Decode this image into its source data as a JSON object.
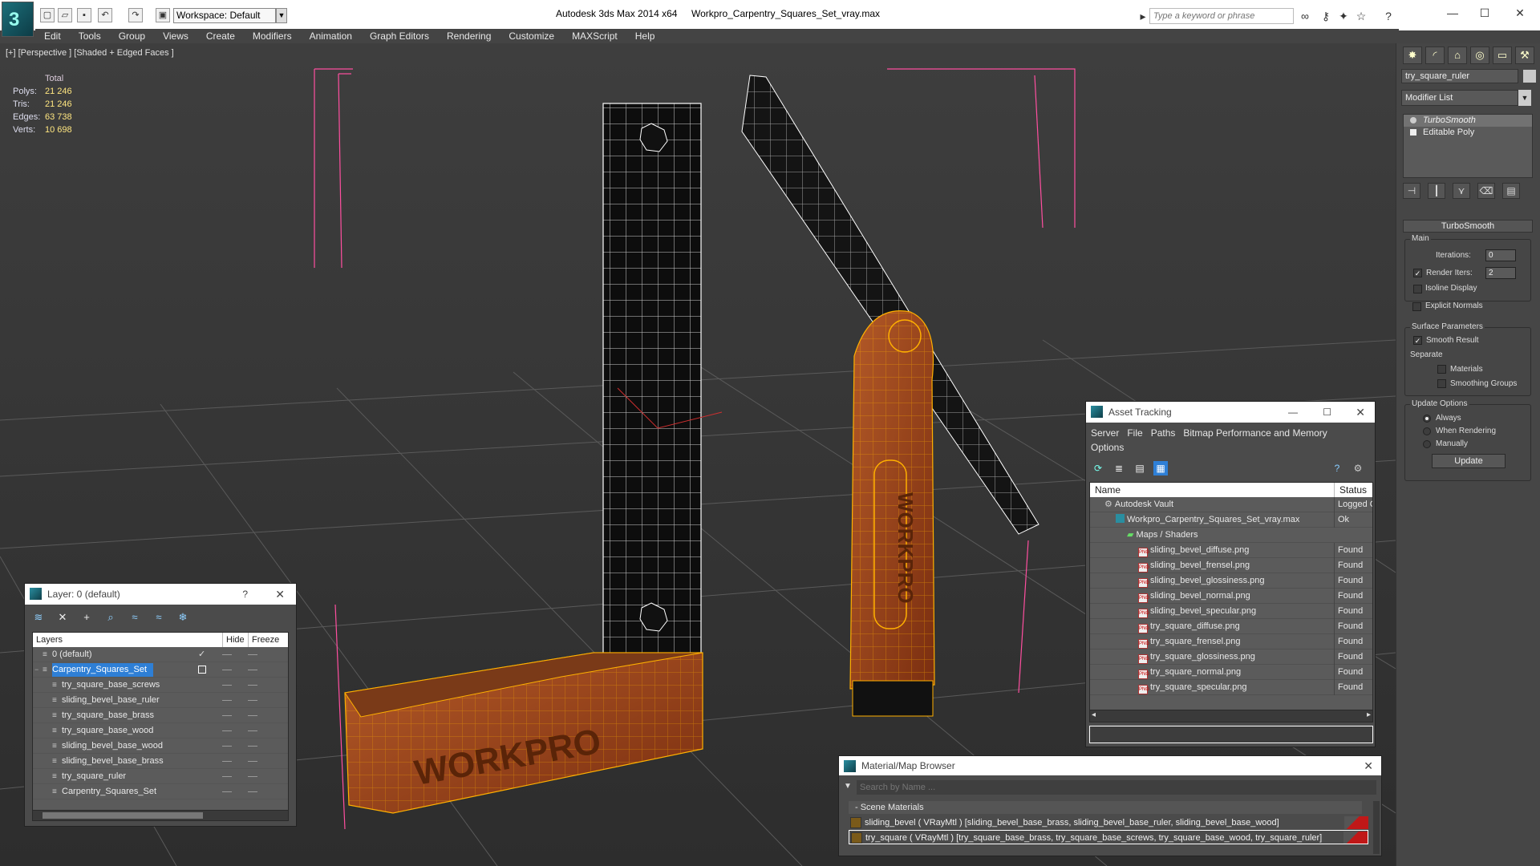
{
  "titlebar": {
    "workspace": "Workspace: Default",
    "app_title": "Autodesk 3ds Max  2014 x64",
    "file_title": "Workpro_Carpentry_Squares_Set_vray.max",
    "search_placeholder": "Type a keyword or phrase"
  },
  "menu": [
    "Edit",
    "Tools",
    "Group",
    "Views",
    "Create",
    "Modifiers",
    "Animation",
    "Graph Editors",
    "Rendering",
    "Customize",
    "MAXScript",
    "Help"
  ],
  "viewport": {
    "label": "[+] [Perspective ] [Shaded + Edged Faces ]",
    "stats_header": "Total",
    "stats": [
      {
        "label": "Polys:",
        "value": "21 246"
      },
      {
        "label": "Tris:",
        "value": "21 246"
      },
      {
        "label": "Edges:",
        "value": "63 738"
      },
      {
        "label": "Verts:",
        "value": "10 698"
      }
    ],
    "model_text_1": "WORKPRO",
    "model_text_2": "WORKPRO"
  },
  "command_panel": {
    "object_name": "try_square_ruler",
    "modifier_list": "Modifier List",
    "stack": [
      "TurboSmooth",
      "Editable Poly"
    ],
    "rollout_title": "TurboSmooth",
    "main_group": "Main",
    "iterations_label": "Iterations:",
    "iterations_value": "0",
    "render_iters_label": "Render Iters:",
    "render_iters_value": "2",
    "isoline_display": "Isoline Display",
    "explicit_normals": "Explicit Normals",
    "surface_group": "Surface Parameters",
    "smooth_result": "Smooth Result",
    "separate_label": "Separate",
    "materials": "Materials",
    "smoothing_groups": "Smoothing Groups",
    "update_group": "Update Options",
    "always": "Always",
    "when_rendering": "When Rendering",
    "manually": "Manually",
    "update_button": "Update"
  },
  "layer_window": {
    "title": "Layer: 0 (default)",
    "help": "?",
    "columns": {
      "layers": "Layers",
      "hide": "Hide",
      "freeze": "Freeze"
    },
    "rows": [
      {
        "name": "0 (default)",
        "level": 0
      },
      {
        "name": "Carpentry_Squares_Set",
        "level": 0
      },
      {
        "name": "try_square_base_screws",
        "level": 1
      },
      {
        "name": "sliding_bevel_base_ruler",
        "level": 1
      },
      {
        "name": "try_square_base_brass",
        "level": 1
      },
      {
        "name": "try_square_base_wood",
        "level": 1
      },
      {
        "name": "sliding_bevel_base_wood",
        "level": 1
      },
      {
        "name": "sliding_bevel_base_brass",
        "level": 1
      },
      {
        "name": "try_square_ruler",
        "level": 1
      },
      {
        "name": "Carpentry_Squares_Set",
        "level": 1
      }
    ]
  },
  "asset_window": {
    "title": "Asset Tracking",
    "menu": [
      "Server",
      "File",
      "Paths",
      "Bitmap Performance and Memory",
      "Options"
    ],
    "columns": {
      "name": "Name",
      "status": "Status"
    },
    "rows": [
      {
        "name": "Autodesk Vault",
        "status": "Logged O",
        "level": 0
      },
      {
        "name": "Workpro_Carpentry_Squares_Set_vray.max",
        "status": "Ok",
        "level": 1
      },
      {
        "name": "Maps / Shaders",
        "status": "",
        "level": 2
      },
      {
        "name": "sliding_bevel_diffuse.png",
        "status": "Found",
        "level": 3
      },
      {
        "name": "sliding_bevel_frensel.png",
        "status": "Found",
        "level": 3
      },
      {
        "name": "sliding_bevel_glossiness.png",
        "status": "Found",
        "level": 3
      },
      {
        "name": "sliding_bevel_normal.png",
        "status": "Found",
        "level": 3
      },
      {
        "name": "sliding_bevel_specular.png",
        "status": "Found",
        "level": 3
      },
      {
        "name": "try_square_diffuse.png",
        "status": "Found",
        "level": 3
      },
      {
        "name": "try_square_frensel.png",
        "status": "Found",
        "level": 3
      },
      {
        "name": "try_square_glossiness.png",
        "status": "Found",
        "level": 3
      },
      {
        "name": "try_square_normal.png",
        "status": "Found",
        "level": 3
      },
      {
        "name": "try_square_specular.png",
        "status": "Found",
        "level": 3
      }
    ]
  },
  "material_browser": {
    "title": "Material/Map Browser",
    "search_placeholder": "Search by Name ...",
    "section": "- Scene Materials",
    "rows": [
      "sliding_bevel ( VRayMtl ) [sliding_bevel_base_brass, sliding_bevel_base_ruler, sliding_bevel_base_wood]",
      "try_square ( VRayMtl ) [try_square_base_brass, try_square_base_screws, try_square_base_wood, try_square_ruler]"
    ]
  },
  "colors": {
    "selection": "#2e7fd6",
    "stats_value": "#ffe680",
    "wood": "#a0461e",
    "wire": "#ffb000",
    "bbox": "#ff4fa0"
  }
}
